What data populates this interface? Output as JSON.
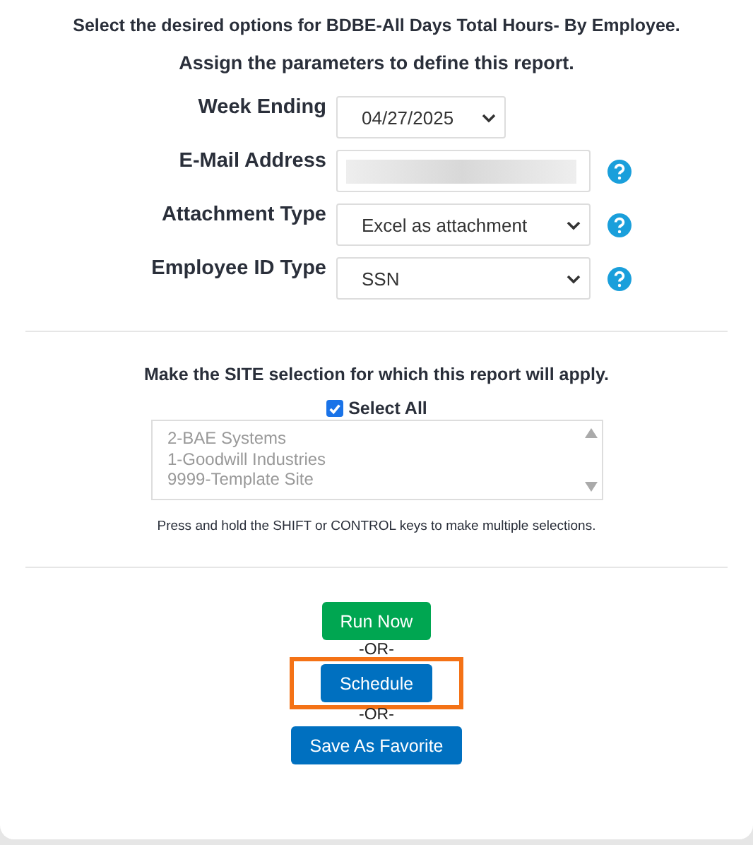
{
  "heading": "Select the desired options for BDBE-All Days Total Hours- By Employee.",
  "subheading": "Assign the parameters to define this report.",
  "fields": [
    {
      "kind": "select",
      "label": "Week Ending",
      "value": "04/27/2025",
      "help": false,
      "wide": false
    },
    {
      "kind": "input",
      "label": "E-Mail Address",
      "help": true,
      "wide": true
    },
    {
      "kind": "select",
      "label": "Attachment Type",
      "value": "Excel as attachment",
      "help": true,
      "wide": true
    },
    {
      "kind": "select",
      "label": "Employee ID Type",
      "value": "SSN",
      "help": true,
      "wide": true
    }
  ],
  "site_prompt": "Make the SITE selection for which this report will apply.",
  "select_all": {
    "label": "Select All",
    "checked": true
  },
  "sites": [
    "2-BAE Systems",
    "1-Goodwill Industries",
    "9999-Template Site"
  ],
  "note": "Press and hold the SHIFT or CONTROL keys to make multiple selections.",
  "actions": [
    {
      "kind": "button",
      "label": "Run Now",
      "color": "#00a651",
      "highlighted": false
    },
    {
      "kind": "separator",
      "label": "-OR-"
    },
    {
      "kind": "button",
      "label": "Schedule",
      "color": "#0070c0",
      "highlighted": true
    },
    {
      "kind": "separator",
      "label": "-OR-"
    },
    {
      "kind": "button",
      "label": "Save As Favorite",
      "color": "#0070c0",
      "highlighted": false
    }
  ]
}
